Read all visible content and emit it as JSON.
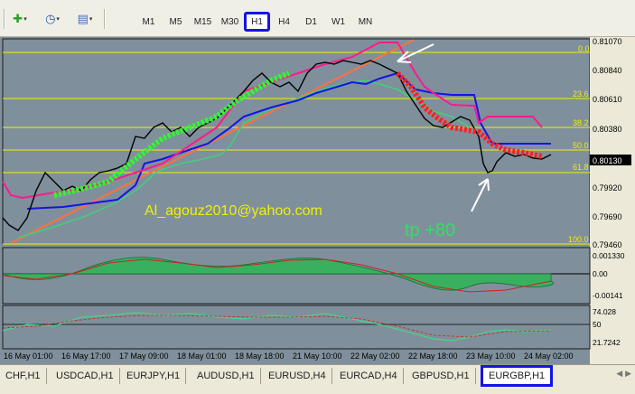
{
  "toolbar": {
    "buttons": [
      {
        "name": "new-chart-icon",
        "glyph": "✚"
      },
      {
        "name": "clock-icon",
        "glyph": "◷"
      },
      {
        "name": "templates-icon",
        "glyph": "▤"
      }
    ],
    "timeframes": [
      "M1",
      "M5",
      "M15",
      "M30",
      "H1",
      "H4",
      "D1",
      "W1",
      "MN"
    ],
    "active_timeframe": "H1"
  },
  "chart": {
    "background": "#7f909c",
    "price_scale": [
      "0.81070",
      "0.80840",
      "0.80610",
      "0.80380",
      "0.80130",
      "0.79920",
      "0.79690",
      "0.79460"
    ],
    "current_price": "0.80130",
    "fib_levels": [
      "0.0",
      "23.6",
      "38.2",
      "50.0",
      "61.8",
      "100.0"
    ],
    "watermark_email": "Al_agouz2010@yahoo.com",
    "watermark_tp": "tp +80",
    "macd_scale": [
      "0.001330",
      "0.00",
      "-0.00141"
    ],
    "rsi_scale": [
      "74.028",
      "50",
      "21.7242"
    ],
    "time_labels": [
      "16 May 01:00",
      "16 May 17:00",
      "17 May 09:00",
      "18 May 01:00",
      "18 May 18:00",
      "21 May 10:00",
      "22 May 02:00",
      "22 May 18:00",
      "23 May 10:00",
      "24 May 02:00"
    ]
  },
  "tabs": [
    "CHF,H1",
    "USDCAD,H1",
    "EURJPY,H1",
    "AUDUSD,H1",
    "EURUSD,H4",
    "EURCAD,H4",
    "GBPUSD,H1",
    "EURGBP,H1"
  ],
  "active_tab": "EURGBP,H1"
}
